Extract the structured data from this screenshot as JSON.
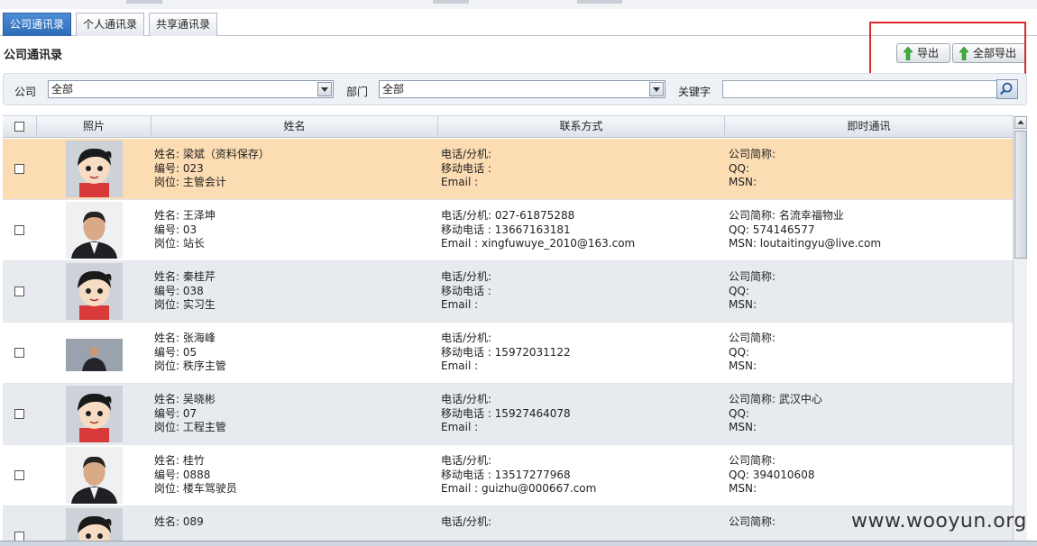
{
  "tabs": [
    {
      "label": "公司通讯录",
      "active": true
    },
    {
      "label": "个人通讯录",
      "active": false
    },
    {
      "label": "共享通讯录",
      "active": false
    }
  ],
  "panel_title": "公司通讯录",
  "toolbar": {
    "export_label": "导出",
    "export_all_label": "全部导出",
    "export_icon": "green-up-arrow-icon"
  },
  "filters": {
    "company_label": "公司",
    "company_value": "全部",
    "department_label": "部门",
    "department_value": "全部",
    "keyword_label": "关键字",
    "keyword_value": ""
  },
  "columns": {
    "photo": "照片",
    "name": "姓名",
    "contact": "联系方式",
    "im": "即时通讯"
  },
  "rows": [
    {
      "style": "sel",
      "photo": "cartoon-avatar",
      "name": "姓名: 梁斌（资料保存）",
      "code": "编号: 023",
      "post": "岗位: 主管会计",
      "phone": "电话/分机:",
      "mobile": "移动电话 :",
      "email": "Email :",
      "company_short": "公司简称:",
      "qq": "QQ:",
      "msn": "MSN:"
    },
    {
      "style": "plain",
      "photo": "person-photo",
      "name": "姓名: 王泽坤",
      "code": "编号: 03",
      "post": "岗位: 站长",
      "phone": "电话/分机: 027-61875288",
      "mobile": "移动电话 : 13667163181",
      "email": "Email : xingfuwuye_2010@163.com",
      "company_short": "公司简称: 名流幸福物业",
      "qq": "QQ: 574146577",
      "msn": "MSN: loutaitingyu@live.com"
    },
    {
      "style": "alt",
      "photo": "cartoon-avatar",
      "name": "姓名: 秦桂芹",
      "code": "编号: 038",
      "post": "岗位: 实习生",
      "phone": "电话/分机:",
      "mobile": "移动电话 :",
      "email": "Email :",
      "company_short": "公司简称:",
      "qq": "QQ:",
      "msn": "MSN:"
    },
    {
      "style": "plain",
      "photo": "person-photo-small",
      "name": "姓名: 张海峰",
      "code": "编号: 05",
      "post": "岗位: 秩序主管",
      "phone": "电话/分机:",
      "mobile": "移动电话 : 15972031122",
      "email": "Email :",
      "company_short": "公司简称:",
      "qq": "QQ:",
      "msn": "MSN:"
    },
    {
      "style": "alt",
      "photo": "cartoon-avatar",
      "name": "姓名: 吴晓彬",
      "code": "编号: 07",
      "post": "岗位: 工程主管",
      "phone": "电话/分机:",
      "mobile": "移动电话 : 15927464078",
      "email": "Email :",
      "company_short": "公司简称: 武汉中心",
      "qq": "QQ:",
      "msn": "MSN:"
    },
    {
      "style": "plain",
      "photo": "person-photo",
      "name": "姓名: 桂竹",
      "code": "编号: 0888",
      "post": "岗位: 楼车驾驶员",
      "phone": "电话/分机:",
      "mobile": "移动电话 : 13517277968",
      "email": "Email : guizhu@000667.com",
      "company_short": "公司简称:",
      "qq": "QQ: 394010608",
      "msn": "MSN:"
    },
    {
      "style": "alt",
      "photo": "cartoon-avatar",
      "name": "姓名: 089",
      "code": "",
      "post": "",
      "phone": "电话/分机:",
      "mobile": "",
      "email": "",
      "company_short": "公司简称:",
      "qq": "",
      "msn": ""
    }
  ],
  "watermark": "www.wooyun.org"
}
